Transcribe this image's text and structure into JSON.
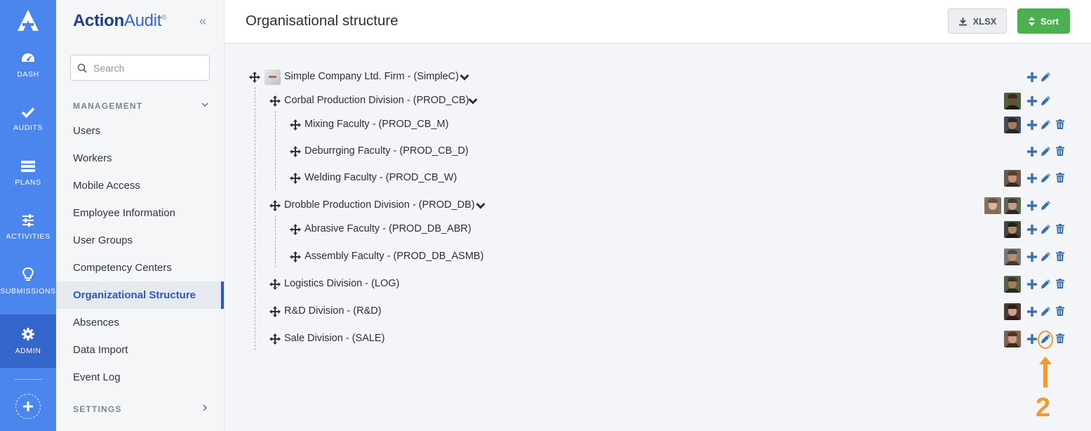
{
  "rail": {
    "items": [
      {
        "label": "DASH",
        "icon": "dashboard-icon"
      },
      {
        "label": "AUDITS",
        "icon": "check-icon"
      },
      {
        "label": "PLANS",
        "icon": "plans-icon"
      },
      {
        "label": "ACTIVITIES",
        "icon": "sliders-icon"
      },
      {
        "label": "SUBMISSIONS",
        "icon": "lightbulb-icon"
      },
      {
        "label": "ADMIN",
        "icon": "gear-icon",
        "active": true
      }
    ]
  },
  "sidebar": {
    "brand_main": "Action",
    "brand_sub": "Audit",
    "brand_mark": "®",
    "search_placeholder": "Search",
    "management_label": "MANAGEMENT",
    "settings_label": "SETTINGS",
    "items": [
      {
        "label": "Users"
      },
      {
        "label": "Workers"
      },
      {
        "label": "Mobile Access"
      },
      {
        "label": "Employee Information"
      },
      {
        "label": "User Groups"
      },
      {
        "label": "Competency Centers"
      },
      {
        "label": "Organizational Structure",
        "active": true
      },
      {
        "label": "Absences"
      },
      {
        "label": "Data Import"
      },
      {
        "label": "Event Log"
      }
    ]
  },
  "header": {
    "title": "Organisational structure",
    "xlsx_label": "XLSX",
    "sort_label": "Sort"
  },
  "tree": [
    {
      "label": "Simple Company Ltd. Firm - (SimpleC)",
      "level": 0,
      "expanded": true,
      "avatars": 0,
      "delete": false
    },
    {
      "label": "Corbal Production Division - (PROD_CB)",
      "level": 1,
      "expanded": true,
      "avatars": 1,
      "delete": false
    },
    {
      "label": "Mixing Faculty - (PROD_CB_M)",
      "level": 2,
      "avatars": 1,
      "delete": true
    },
    {
      "label": "Deburrging Faculty - (PROD_CB_D)",
      "level": 2,
      "avatars": 0,
      "delete": true
    },
    {
      "label": "Welding Faculty - (PROD_CB_W)",
      "level": 2,
      "avatars": 1,
      "delete": true
    },
    {
      "label": "Drobble Production Division - (PROD_DB)",
      "level": 1,
      "expanded": true,
      "avatars": 2,
      "delete": false
    },
    {
      "label": "Abrasive Faculty - (PROD_DB_ABR)",
      "level": 2,
      "avatars": 1,
      "delete": true
    },
    {
      "label": "Assembly Faculty - (PROD_DB_ASMB)",
      "level": 2,
      "avatars": 1,
      "delete": true
    },
    {
      "label": "Logistics Division - (LOG)",
      "level": 1,
      "avatars": 1,
      "delete": true
    },
    {
      "label": "R&D Division - (R&D)",
      "level": 1,
      "avatars": 1,
      "delete": true
    },
    {
      "label": "Sale Division - (SALE)",
      "level": 1,
      "avatars": 1,
      "delete": true
    }
  ],
  "annotation": {
    "step_number": "2",
    "accent_color": "#f39a2e"
  },
  "colors": {
    "rail_bg": "#4a86ee",
    "rail_active": "#3466cc",
    "action_icon": "#3a6fb0",
    "sort_button": "#4caf50"
  }
}
